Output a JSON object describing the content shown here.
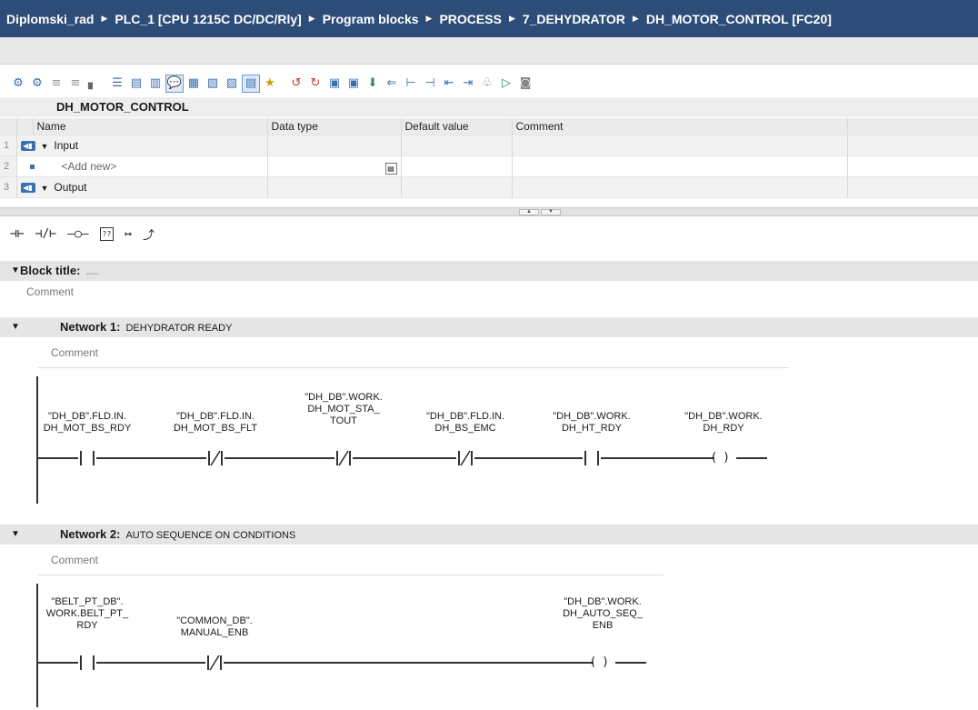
{
  "breadcrumb": [
    "Diplomski_rad",
    "PLC_1 [CPU 1215C DC/DC/Rly]",
    "Program blocks",
    "PROCESS",
    "7_DEHYDRATOR",
    "DH_MOTOR_CONTROL [FC20]"
  ],
  "toolbar_icons": [
    "monitor-all-icon",
    "monitor-off-icon",
    "enable-icon",
    "disable-icon",
    "insert-row-icon",
    "list-icon",
    "list2-icon",
    "list3-icon",
    "comment-icon",
    "absolute-icon",
    "sym-icon",
    "view-icon",
    "table-icon",
    "favorites-icon",
    "goto-icon",
    "goto2-icon",
    "goto3-icon",
    "nav-icon",
    "nav2-icon",
    "box-icon",
    "box2-icon",
    "box3-icon",
    "call-icon",
    "call2-icon",
    "compare-icon",
    "monitor-icon",
    "db-icon"
  ],
  "interface": {
    "title": "DH_MOTOR_CONTROL",
    "columns": [
      "Name",
      "Data type",
      "Default value",
      "Comment"
    ],
    "rows": [
      {
        "num": "1",
        "name": "Input",
        "type": "",
        "default": "",
        "comment": ""
      },
      {
        "num": "2",
        "name": "<Add new>",
        "type": "",
        "default": "",
        "comment": ""
      },
      {
        "num": "3",
        "name": "Output",
        "type": "",
        "default": "",
        "comment": ""
      }
    ]
  },
  "lad_favorites": [
    "⊣⊢",
    "⊣/⊢",
    "–○–",
    "??",
    "↦",
    "⤴"
  ],
  "block": {
    "label": "Block title:",
    "placeholder": ".....",
    "comment": "Comment"
  },
  "network1": {
    "label": "Network 1:",
    "title": "DEHYDRATOR READY",
    "comment": "Comment",
    "elements": [
      {
        "kind": "NO",
        "l1": "\"DH_DB\".FLD.IN.",
        "l2": "DH_MOT_BS_RDY",
        "l3": ""
      },
      {
        "kind": "NC",
        "l1": "\"DH_DB\".FLD.IN.",
        "l2": "DH_MOT_BS_FLT",
        "l3": ""
      },
      {
        "kind": "NC",
        "l1": "\"DH_DB\".WORK.",
        "l2": "DH_MOT_STA_",
        "l3": "TOUT"
      },
      {
        "kind": "NC",
        "l1": "\"DH_DB\".FLD.IN.",
        "l2": "DH_BS_EMC",
        "l3": ""
      },
      {
        "kind": "NO",
        "l1": "\"DH_DB\".WORK.",
        "l2": "DH_HT_RDY",
        "l3": ""
      },
      {
        "kind": "COIL",
        "l1": "\"DH_DB\".WORK.",
        "l2": "DH_RDY",
        "l3": ""
      }
    ]
  },
  "network2": {
    "label": "Network 2:",
    "title": "AUTO SEQUENCE ON CONDITIONS",
    "comment": "Comment",
    "elements": [
      {
        "kind": "NO",
        "l1": "\"BELT_PT_DB\".",
        "l2": "WORK.BELT_PT_",
        "l3": "RDY"
      },
      {
        "kind": "NC",
        "l1": "\"COMMON_DB\".",
        "l2": "MANUAL_ENB",
        "l3": ""
      },
      {
        "kind": "COIL",
        "l1": "\"DH_DB\".WORK.",
        "l2": "DH_AUTO_SEQ_",
        "l3": "ENB"
      }
    ]
  }
}
